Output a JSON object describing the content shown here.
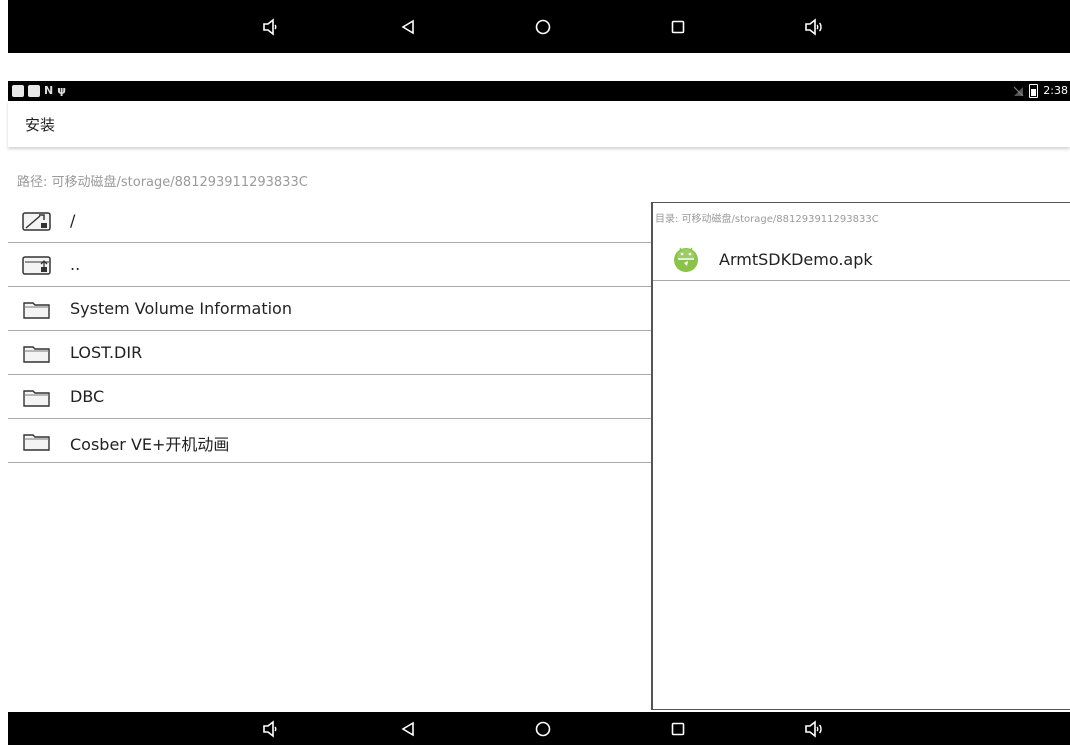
{
  "system_nav": {
    "buttons": [
      {
        "name": "volume-down-icon"
      },
      {
        "name": "back-icon"
      },
      {
        "name": "home-icon"
      },
      {
        "name": "recents-icon"
      },
      {
        "name": "volume-up-icon"
      }
    ]
  },
  "status_bar": {
    "time": "2:38"
  },
  "app_bar": {
    "title": "安装"
  },
  "path": {
    "text": "路径: 可移动磁盘/storage/881293911293833C"
  },
  "folders": [
    {
      "label": "/",
      "icon": "folder-root-icon"
    },
    {
      "label": "..",
      "icon": "folder-up-icon"
    },
    {
      "label": "System Volume Information",
      "icon": "folder-icon"
    },
    {
      "label": "LOST.DIR",
      "icon": "folder-icon"
    },
    {
      "label": "DBC",
      "icon": "folder-icon"
    },
    {
      "label": "Cosber VE+开机动画",
      "icon": "folder-icon"
    }
  ],
  "files_panel": {
    "dir_label": "目录:  可移动磁盘/storage/881293911293833C",
    "files": [
      {
        "label": "ArmtSDKDemo.apk",
        "icon": "android-apk-icon"
      }
    ]
  },
  "colors": {
    "android_green": "#8bc34a",
    "divider": "#a9a9a9",
    "muted_text": "#9a9a9a"
  }
}
